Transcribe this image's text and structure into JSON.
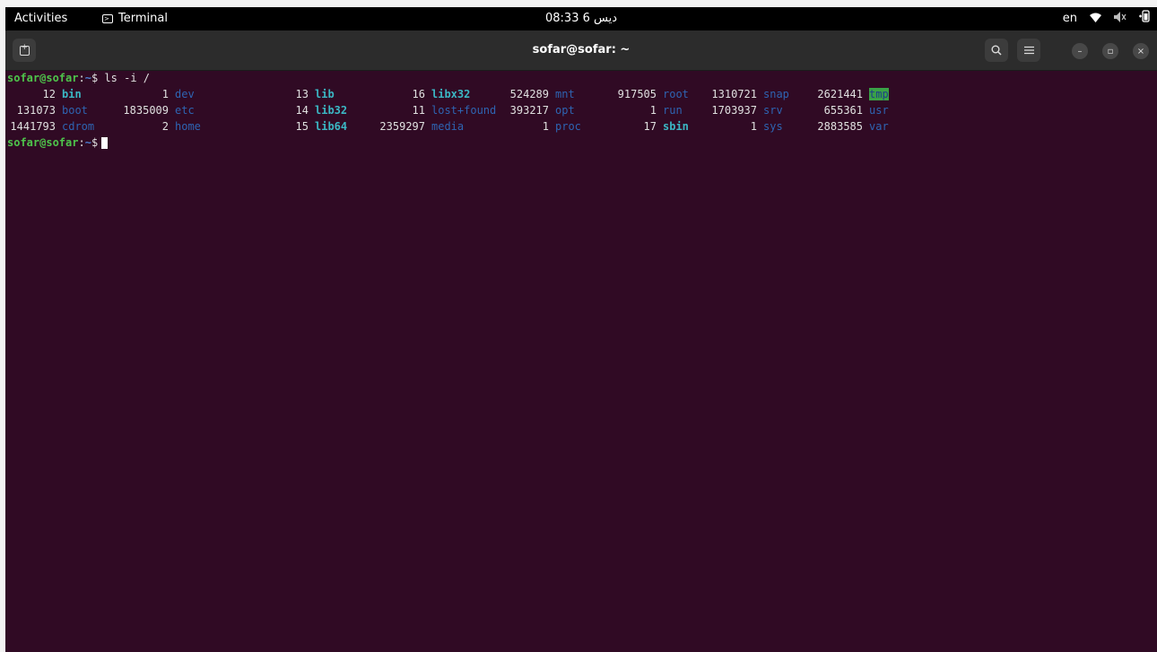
{
  "topbar": {
    "activities": "Activities",
    "app_name": "Terminal",
    "clock": "08:33 6 ديس",
    "language": "en",
    "icons": [
      "wifi-icon",
      "volume-muted-icon",
      "battery-icon"
    ]
  },
  "window": {
    "title": "sofar@sofar: ~",
    "buttons": {
      "search": "search-icon",
      "menu": "hamburger-menu-icon",
      "minimize": "–",
      "maximize": "▫",
      "close": "×"
    }
  },
  "terminal": {
    "prompt_user": "sofar@sofar",
    "prompt_sep": ":",
    "prompt_path": "~",
    "prompt_dollar": "$",
    "command": "ls -i /",
    "rows": [
      [
        {
          "num": "12",
          "name": "bin",
          "kind": "link"
        },
        {
          "num": "1",
          "name": "dev",
          "kind": "dir"
        },
        {
          "num": "13",
          "name": "lib",
          "kind": "link"
        },
        {
          "num": "16",
          "name": "libx32",
          "kind": "link"
        },
        {
          "num": "524289",
          "name": "mnt",
          "kind": "dir"
        },
        {
          "num": "917505",
          "name": "root",
          "kind": "dir"
        },
        {
          "num": "1310721",
          "name": "snap",
          "kind": "dir"
        },
        {
          "num": "2621441",
          "name": "tmp",
          "kind": "tmp"
        }
      ],
      [
        {
          "num": "131073",
          "name": "boot",
          "kind": "dir"
        },
        {
          "num": "1835009",
          "name": "etc",
          "kind": "dir"
        },
        {
          "num": "14",
          "name": "lib32",
          "kind": "link"
        },
        {
          "num": "11",
          "name": "lost+found",
          "kind": "dir"
        },
        {
          "num": "393217",
          "name": "opt",
          "kind": "dir"
        },
        {
          "num": "1",
          "name": "run",
          "kind": "dir"
        },
        {
          "num": "1703937",
          "name": "srv",
          "kind": "dir"
        },
        {
          "num": "655361",
          "name": "usr",
          "kind": "dir"
        }
      ],
      [
        {
          "num": "1441793",
          "name": "cdrom",
          "kind": "dir"
        },
        {
          "num": "2",
          "name": "home",
          "kind": "dir"
        },
        {
          "num": "15",
          "name": "lib64",
          "kind": "link"
        },
        {
          "num": "2359297",
          "name": "media",
          "kind": "dir"
        },
        {
          "num": "1",
          "name": "proc",
          "kind": "dir"
        },
        {
          "num": "17",
          "name": "sbin",
          "kind": "link"
        },
        {
          "num": "1",
          "name": "sys",
          "kind": "dir"
        },
        {
          "num": "2883585",
          "name": "var",
          "kind": "dir"
        }
      ]
    ],
    "colors": {
      "background": "#300a24",
      "prompt_user": "#4ec44b",
      "prompt_path": "#4d7fd0",
      "dir": "#2e64b2",
      "link": "#3bb7c4",
      "tmp_bg": "#3aa246"
    }
  }
}
